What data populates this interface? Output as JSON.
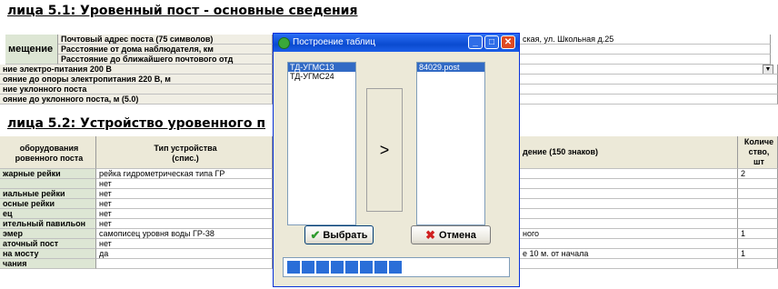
{
  "section1": {
    "heading": "лица 5.1: Уровенный  пост - основные сведения",
    "group_label": "мещение",
    "rows": [
      {
        "label": "Почтовый адрес поста (75 символов)",
        "value": "ская, ул. Школьная д.25"
      },
      {
        "label": "Расстояние от  дома наблюдателя, км",
        "value": ""
      },
      {
        "label": "Расстояние до ближайшего почтового отд",
        "value": ""
      }
    ],
    "rows_full": [
      {
        "label": "ние электро-питания 200 В",
        "value": ""
      },
      {
        "label": "ояние до опоры электропитания 220 В, м",
        "value": ""
      },
      {
        "label": "ние уклонного поста",
        "value": ""
      },
      {
        "label": "ояние до уклонного поста, м (5.0)",
        "value": ""
      }
    ]
  },
  "section2": {
    "heading": "лица 5.2: Устройство уровенного п",
    "columns": {
      "equipment": "оборудования\nровенного поста",
      "type": "Тип устройства\n(спис.)",
      "description": "дение (150 знаков)",
      "count": "Количе\nство,\nшт"
    },
    "rows": [
      {
        "name": "жарные рейки",
        "type": "рейка гидрометрическая типа ГР",
        "desc": "",
        "count": "2"
      },
      {
        "name": "",
        "type": "нет",
        "desc": "",
        "count": ""
      },
      {
        "name": "иальные рейки",
        "type": "нет",
        "desc": "",
        "count": ""
      },
      {
        "name": "осные рейки",
        "type": "нет",
        "desc": "",
        "count": ""
      },
      {
        "name": "ец",
        "type": "нет",
        "desc": "",
        "count": ""
      },
      {
        "name": "ительный павильон",
        "type": "нет",
        "desc": "",
        "count": ""
      },
      {
        "name": "эмер",
        "type": "самописец уровня воды ГР-38",
        "desc": "ного",
        "count": "1"
      },
      {
        "name": "аточный пост",
        "type": "нет",
        "desc": "",
        "count": ""
      },
      {
        "name": "на мосту",
        "type": "да",
        "desc": "е 10 м. от начала",
        "count": "1"
      },
      {
        "name": "чания",
        "type": "",
        "desc": "",
        "count": ""
      }
    ]
  },
  "dialog": {
    "title": "Построение таблиц",
    "left_list": [
      "ТД-УГМС13",
      "ТД-УГМС24"
    ],
    "right_list": [
      "84029.post"
    ],
    "move_label": ">",
    "ok_label": "Выбрать",
    "cancel_label": "Отмена",
    "progress_blocks": 8
  }
}
